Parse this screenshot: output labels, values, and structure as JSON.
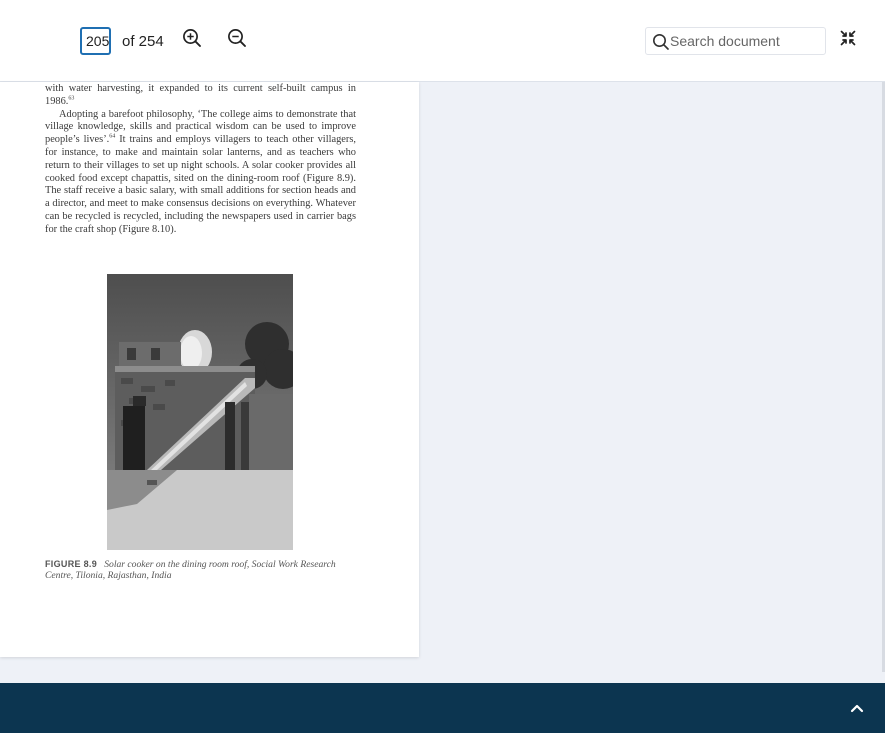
{
  "toolbar": {
    "page_input_value": "205",
    "page_total_label": "of 254",
    "zoom_in_icon": "zoom-in-icon",
    "zoom_out_icon": "zoom-out-icon",
    "search_placeholder": "Search document",
    "search_icon": "search-icon",
    "exit_fullscreen_icon": "collapse-icon"
  },
  "document": {
    "paragraph_1": "with water harvesting, it expanded to its current self-built campus in 1986.",
    "paragraph_1_note": "63",
    "paragraph_2_a": "Adopting a barefoot philosophy, ‘The college aims to demonstrate that village knowledge, skills and practical wisdom can be used to improve people’s lives’.",
    "paragraph_2_note": "64",
    "paragraph_2_b": " It trains and employs villagers to teach other villagers, for instance, to make and maintain solar lanterns, and as teachers who return to their villages to set up night schools. A solar cooker provides all cooked food except chapattis, sited on the dining-room roof (Figure 8.9). The staff receive a basic salary, with small additions for section heads and a director, and meet to make consensus decisions on everything. Whatever can be recycled is recycled, including the newspapers used in carrier bags for the craft shop (Figure 8.10).",
    "figure_label": "FIGURE 8.9",
    "figure_caption": "Solar cooker on the dining room roof, Social Work Research Centre, Tilonia, Rajasthan, India"
  },
  "footer": {
    "scroll_top_icon": "chevron-up-icon"
  },
  "colors": {
    "accent": "#1f6fb2",
    "footer_bg": "#0c3550",
    "viewer_bg": "#eef1f7"
  }
}
